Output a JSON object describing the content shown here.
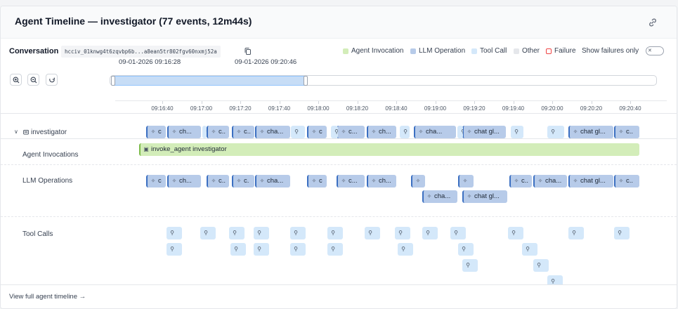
{
  "header": {
    "title": "Agent Timeline — investigator (77 events, 12m44s)"
  },
  "conversation": {
    "label": "Conversation",
    "id": "hcciv_01knwg4t6zqvbp6b...a8ean5tr802fgv60nxmj52a"
  },
  "legend": {
    "agent": "Agent Invocation",
    "llm": "LLM Operation",
    "tool": "Tool Call",
    "other": "Other",
    "failure": "Failure",
    "show_failures": "Show failures only"
  },
  "colors": {
    "agent": "#d3edb9",
    "llm": "#b7cbe9",
    "tool": "#d4e8fa",
    "other": "#e5e7eb",
    "failure": "#ef4444"
  },
  "range": {
    "start": "09-01-2026 09:16:28",
    "end": "09-01-2026 09:20:46"
  },
  "ticks": [
    "09:16:40",
    "09:17:00",
    "09:17:20",
    "09:17:40",
    "09:18:00",
    "09:18:20",
    "09:18:40",
    "09:19:00",
    "09:19:20",
    "09:19:40",
    "09:20:00",
    "09:20:20",
    "09:20:40"
  ],
  "rows": {
    "investigator": "investigator",
    "agent_invocations": "Agent Invocations",
    "llm_operations": "LLM Operations",
    "tool_calls": "Tool Calls"
  },
  "agent_bar": {
    "label": "invoke_agent investigator"
  },
  "summary_labels": [
    "c",
    "ch...",
    "c..",
    "c..",
    "cha...",
    "c",
    "c...",
    "ch...",
    "cha...",
    "chat gl...",
    "chat gl...",
    "c.."
  ],
  "llm_labels": [
    "c",
    "ch...",
    "c..",
    "c.",
    "cha...",
    "c",
    "c...",
    "ch...",
    "",
    "",
    "c..",
    "cha...",
    "chat gl...",
    "c..",
    "cha...",
    "chat gl..."
  ],
  "footer": {
    "link": "View full agent timeline →"
  }
}
